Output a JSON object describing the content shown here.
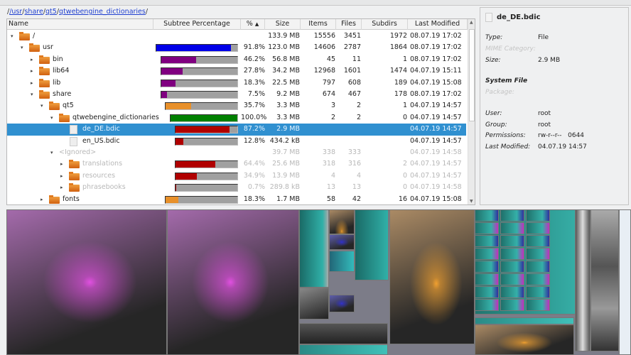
{
  "breadcrumb": [
    "/usr",
    "share",
    "qt5",
    "qtwebengine_dictionaries"
  ],
  "columns": [
    "Name",
    "Subtree Percentage",
    "%",
    "Size",
    "Items",
    "Files",
    "Subdirs",
    "Last Modified"
  ],
  "sort_indicator": "▲",
  "rows": [
    {
      "name": "/",
      "arrow": "▾",
      "icon": "folder",
      "depth": 0,
      "pct": "",
      "size": "133.9 MB",
      "items": "15556",
      "files": "3451",
      "subdirs": "1972",
      "modified": "08.07.19 17:02"
    },
    {
      "name": "usr",
      "arrow": "▾",
      "icon": "folder",
      "depth": 1,
      "pct": "91.8%",
      "fill": 91.8,
      "color": "#0000e8",
      "size": "123.0 MB",
      "items": "14606",
      "files": "2787",
      "subdirs": "1864",
      "modified": "08.07.19 17:02"
    },
    {
      "name": "bin",
      "arrow": "▸",
      "icon": "folder",
      "depth": 2,
      "pct": "46.2%",
      "fill": 46.2,
      "color": "#800080",
      "size": "56.8 MB",
      "items": "45",
      "files": "11",
      "subdirs": "1",
      "modified": "08.07.19 17:02"
    },
    {
      "name": "lib64",
      "arrow": "▸",
      "icon": "folder",
      "depth": 2,
      "pct": "27.8%",
      "fill": 27.8,
      "color": "#800080",
      "size": "34.2 MB",
      "items": "12968",
      "files": "1601",
      "subdirs": "1474",
      "modified": "04.07.19 15:11"
    },
    {
      "name": "lib",
      "arrow": "▸",
      "icon": "folder",
      "depth": 2,
      "pct": "18.3%",
      "fill": 18.3,
      "color": "#800080",
      "size": "22.5 MB",
      "items": "797",
      "files": "608",
      "subdirs": "189",
      "modified": "04.07.19 15:08"
    },
    {
      "name": "share",
      "arrow": "▾",
      "icon": "folder",
      "depth": 2,
      "pct": "7.5%",
      "fill": 7.5,
      "color": "#800080",
      "size": "9.2 MB",
      "items": "674",
      "files": "467",
      "subdirs": "178",
      "modified": "08.07.19 17:02"
    },
    {
      "name": "qt5",
      "arrow": "▾",
      "icon": "folder",
      "depth": 3,
      "pct": "35.7%",
      "fill": 35.7,
      "color": "#e8902a",
      "size": "3.3 MB",
      "items": "3",
      "files": "2",
      "subdirs": "1",
      "modified": "04.07.19 14:57"
    },
    {
      "name": "qtwebengine_dictionaries",
      "arrow": "▾",
      "icon": "folder",
      "depth": 4,
      "pct": "100.0%",
      "fill": 100,
      "color": "#008000",
      "size": "3.3 MB",
      "items": "2",
      "files": "2",
      "subdirs": "0",
      "modified": "04.07.19 14:57"
    },
    {
      "name": "de_DE.bdic",
      "arrow": "",
      "icon": "file",
      "depth": 5,
      "pct": "87.2%",
      "fill": 87.2,
      "color": "#b00000",
      "size": "2.9 MB",
      "items": "",
      "files": "",
      "subdirs": "",
      "modified": "04.07.19 14:57",
      "selected": true
    },
    {
      "name": "en_US.bdic",
      "arrow": "",
      "icon": "file",
      "depth": 5,
      "pct": "12.8%",
      "fill": 12.8,
      "color": "#b00000",
      "size": "434.2 kB",
      "items": "",
      "files": "",
      "subdirs": "",
      "modified": "04.07.19 14:57"
    },
    {
      "name": "<Ignored>",
      "arrow": "▾",
      "icon": "",
      "depth": 4,
      "pct": "",
      "size": "39.7 MB",
      "items": "338",
      "files": "333",
      "subdirs": "",
      "modified": "04.07.19 14:58",
      "ignored": true
    },
    {
      "name": "translations",
      "arrow": "▸",
      "icon": "folder",
      "depth": 5,
      "pct": "64.4%",
      "fill": 64.4,
      "color": "#b00000",
      "size": "25.6 MB",
      "items": "318",
      "files": "316",
      "subdirs": "2",
      "modified": "04.07.19 14:57",
      "ignored": true
    },
    {
      "name": "resources",
      "arrow": "▸",
      "icon": "folder",
      "depth": 5,
      "pct": "34.9%",
      "fill": 34.9,
      "color": "#b00000",
      "size": "13.9 MB",
      "items": "4",
      "files": "4",
      "subdirs": "0",
      "modified": "04.07.19 14:57",
      "ignored": true
    },
    {
      "name": "phrasebooks",
      "arrow": "▸",
      "icon": "folder",
      "depth": 5,
      "pct": "0.7%",
      "fill": 0.7,
      "color": "#b00000",
      "size": "289.8 kB",
      "items": "13",
      "files": "13",
      "subdirs": "0",
      "modified": "04.07.19 14:58",
      "ignored": true
    },
    {
      "name": "fonts",
      "arrow": "▸",
      "icon": "folder",
      "depth": 3,
      "pct": "18.3%",
      "fill": 18.3,
      "color": "#e8902a",
      "size": "1.7 MB",
      "items": "58",
      "files": "42",
      "subdirs": "16",
      "modified": "04.07.19 15:08"
    }
  ],
  "details": {
    "title": "de_DE.bdic",
    "type_label": "Type:",
    "type": "File",
    "mime_label": "MIME Category:",
    "size_label": "Size:",
    "size": "2.9 MB",
    "system_file": "System File",
    "package_label": "Package:",
    "user_label": "User:",
    "user": "root",
    "group_label": "Group:",
    "group": "root",
    "perm_label": "Permissions:",
    "perm": "rw-r--r--   0644",
    "mod_label": "Last Modified:",
    "mod": "04.07.19 14:57"
  }
}
